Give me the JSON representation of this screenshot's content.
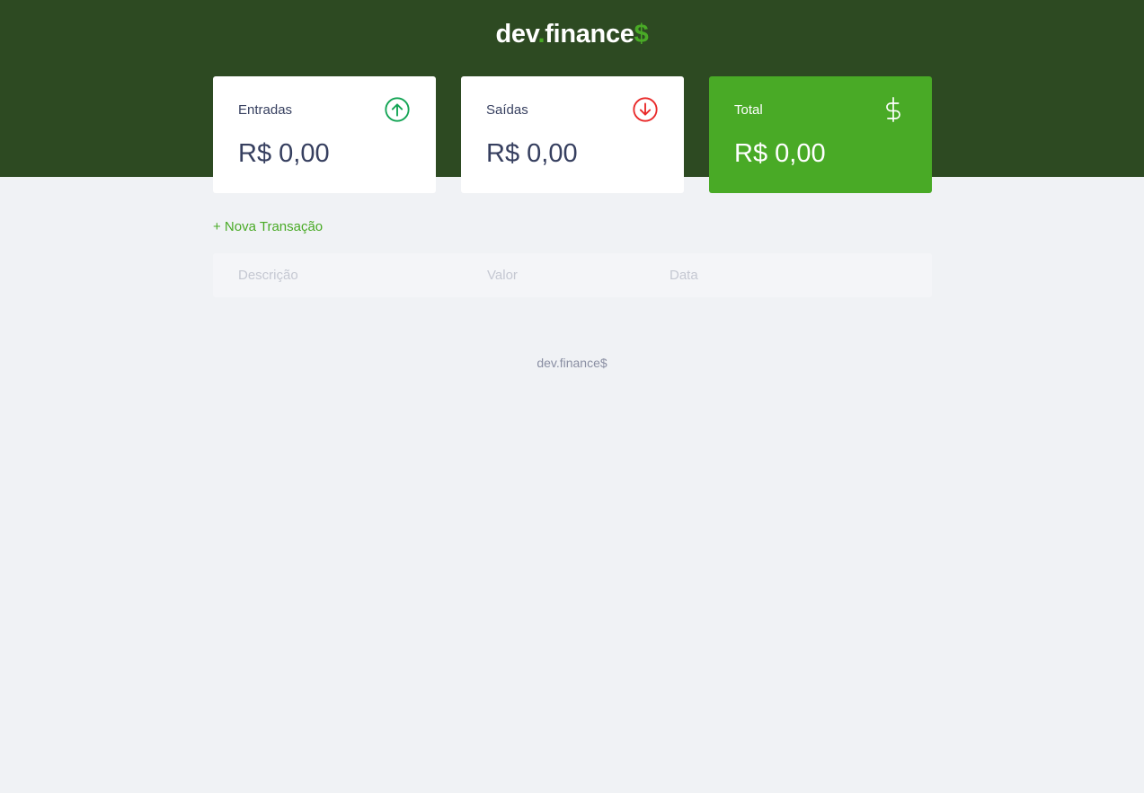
{
  "header": {
    "logo_part1": "dev",
    "logo_dot": ".",
    "logo_part2": "finance",
    "logo_dollar": "$"
  },
  "cards": {
    "income": {
      "label": "Entradas",
      "value": "R$ 0,00",
      "icon": "arrow-up-circle-icon",
      "icon_color": "#12a454"
    },
    "expense": {
      "label": "Saídas",
      "value": "R$ 0,00",
      "icon": "arrow-down-circle-icon",
      "icon_color": "#e92929"
    },
    "total": {
      "label": "Total",
      "value": "R$ 0,00",
      "icon": "dollar-sign-icon",
      "bg_color": "#49aa26"
    }
  },
  "actions": {
    "new_transaction": "+ Nova Transação"
  },
  "table": {
    "columns": [
      "Descrição",
      "Valor",
      "Data"
    ],
    "rows": []
  },
  "footer": {
    "text": "dev.finance$"
  },
  "colors": {
    "header_bg": "#2d4a22",
    "page_bg": "#f0f2f5",
    "accent": "#49aa26",
    "text": "#363f5f"
  }
}
